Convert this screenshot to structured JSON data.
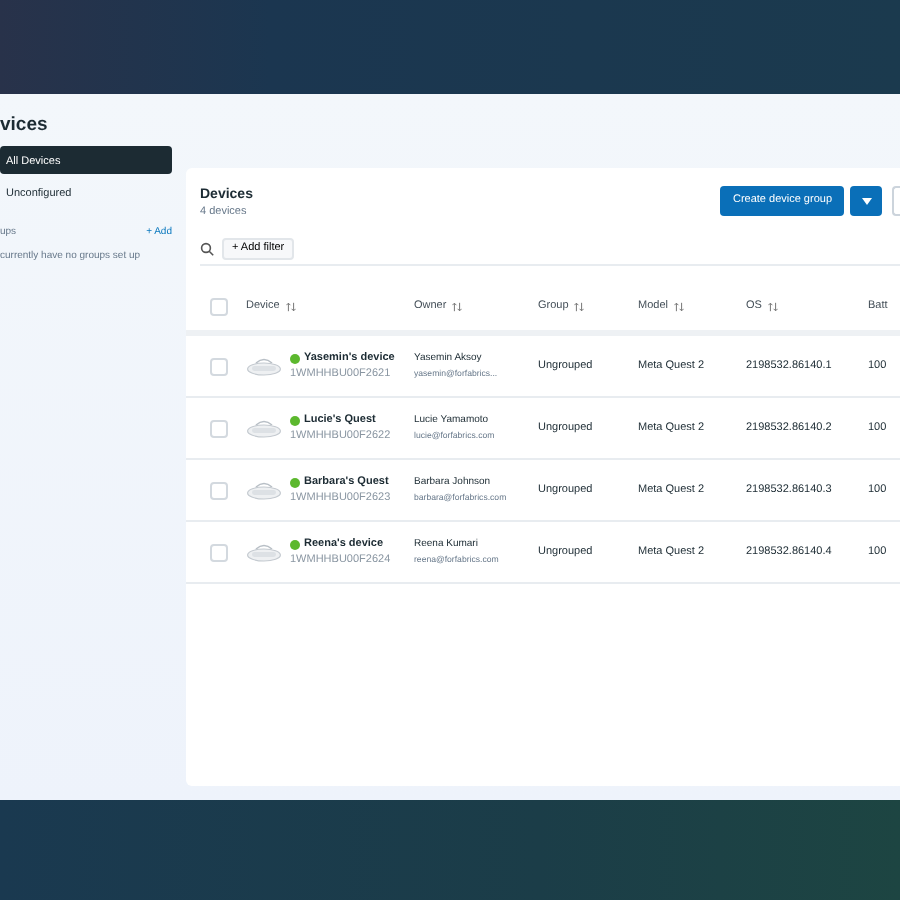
{
  "page_title": "vices",
  "sidebar": {
    "items": [
      {
        "label": "All Devices",
        "selected": true
      },
      {
        "label": "Unconfigured",
        "selected": false
      }
    ],
    "groups": {
      "label": "ups",
      "add_link": "+ Add",
      "empty_text": "currently have no groups set up"
    }
  },
  "panel": {
    "title": "Devices",
    "subtitle": "4 devices",
    "primary_button": "Create device group",
    "add_filter": "+ Add filter"
  },
  "table": {
    "select_all_checked": false,
    "columns": [
      "Device",
      "Owner",
      "Group",
      "Model",
      "OS",
      "Batt"
    ],
    "rows": [
      {
        "name": "Yasemin's device",
        "serial": "1WMHHBU00F2621",
        "color": "#5cb82e",
        "owner": "Yasemin Aksoy",
        "email": "yasemin@forfabrics...",
        "group": "Ungrouped",
        "model": "Meta Quest 2",
        "os": "2198532.86140.1",
        "battery": "100",
        "checked": false
      },
      {
        "name": "Lucie's Quest",
        "serial": "1WMHHBU00F2622",
        "color": "#5cb82e",
        "owner": "Lucie Yamamoto",
        "email": "lucie@forfabrics.com",
        "group": "Ungrouped",
        "model": "Meta Quest 2",
        "os": "2198532.86140.2",
        "battery": "100",
        "checked": false
      },
      {
        "name": "Barbara's Quest",
        "serial": "1WMHHBU00F2623",
        "color": "#5cb82e",
        "owner": "Barbara Johnson",
        "email": "barbara@forfabrics.com",
        "group": "Ungrouped",
        "model": "Meta Quest 2",
        "os": "2198532.86140.3",
        "battery": "100",
        "checked": false
      },
      {
        "name": "Reena's device",
        "serial": "1WMHHBU00F2624",
        "color": "#5cb82e",
        "owner": "Reena Kumari",
        "email": "reena@forfabrics.com",
        "group": "Ungrouped",
        "model": "Meta Quest 2",
        "os": "2198532.86140.4",
        "battery": "100",
        "checked": false
      }
    ]
  }
}
